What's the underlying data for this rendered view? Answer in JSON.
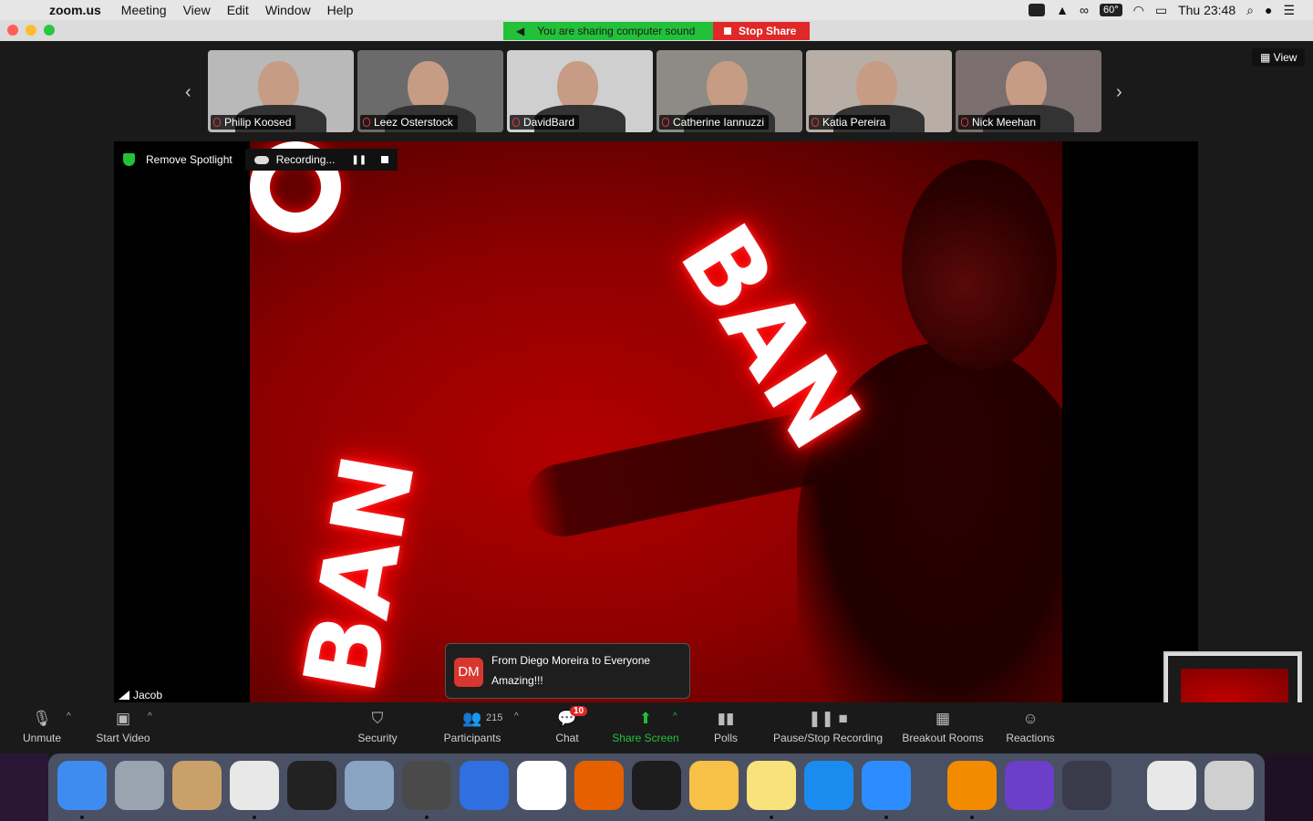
{
  "menubar": {
    "app_name": "zoom.us",
    "menus": [
      "Meeting",
      "View",
      "Edit",
      "Window",
      "Help"
    ],
    "temperature": "60°",
    "clock": "Thu 23:48"
  },
  "share_banner": {
    "message": "You are sharing computer sound",
    "stop_label": "Stop Share"
  },
  "view_button": "View",
  "participants": [
    {
      "name": "Philip Koosed",
      "bg": "#b9b9b9"
    },
    {
      "name": "Leez Osterstock",
      "bg": "#6b6b6b"
    },
    {
      "name": "DavidBard",
      "bg": "#cfcfcf"
    },
    {
      "name": "Catherine Iannuzzi",
      "bg": "#8e8a86"
    },
    {
      "name": "Katia Pereira",
      "bg": "#b8aea6"
    },
    {
      "name": "Nick Meehan",
      "bg": "#7a6e6e"
    }
  ],
  "spotlight": {
    "remove_label": "Remove Spotlight",
    "recording_label": "Recording..."
  },
  "speaker": {
    "name": "Jacob"
  },
  "chat_toast": {
    "avatar_initials": "DM",
    "from": "From Diego Moreira to Everyone",
    "message": "Amazing!!!"
  },
  "toolbar": {
    "unmute": "Unmute",
    "start_video": "Start Video",
    "security": "Security",
    "participants": "Participants",
    "participant_count": "215",
    "chat": "Chat",
    "chat_badge": "10",
    "share_screen": "Share Screen",
    "polls": "Polls",
    "pause_stop_recording": "Pause/Stop Recording",
    "breakout_rooms": "Breakout Rooms",
    "reactions": "Reactions"
  },
  "dock": [
    {
      "icon": "finder-icon",
      "color": "#3f8cf0"
    },
    {
      "icon": "launchpad-icon",
      "color": "#9aa3b0"
    },
    {
      "icon": "mail-stamp-icon",
      "color": "#c9a06a"
    },
    {
      "icon": "chrome-icon",
      "color": "#e8e8e8"
    },
    {
      "icon": "terminal-icon",
      "color": "#222222"
    },
    {
      "icon": "preview-icon",
      "color": "#8aa5c4"
    },
    {
      "icon": "sublime-icon",
      "color": "#4a4a4a"
    },
    {
      "icon": "keynote-icon",
      "color": "#2f6fe0"
    },
    {
      "icon": "numbers-icon",
      "color": "#ffffff"
    },
    {
      "icon": "firefox-icon",
      "color": "#e66000"
    },
    {
      "icon": "activity-monitor-icon",
      "color": "#1d1d1d"
    },
    {
      "icon": "pages-icon",
      "color": "#f7c046"
    },
    {
      "icon": "notes-icon",
      "color": "#f7e27b"
    },
    {
      "icon": "app-store-icon",
      "color": "#1a8cf0"
    },
    {
      "icon": "zoom-icon",
      "color": "#2d8cff"
    },
    {
      "icon": "vlc-icon",
      "color": "#f38b00"
    },
    {
      "icon": "imovie-icon",
      "color": "#6b3fc7"
    },
    {
      "icon": "quicktime-icon",
      "color": "#3a3a4a"
    },
    {
      "icon": "document-icon",
      "color": "#e8e8e8"
    },
    {
      "icon": "trash-icon",
      "color": "#cfcfcf"
    }
  ]
}
